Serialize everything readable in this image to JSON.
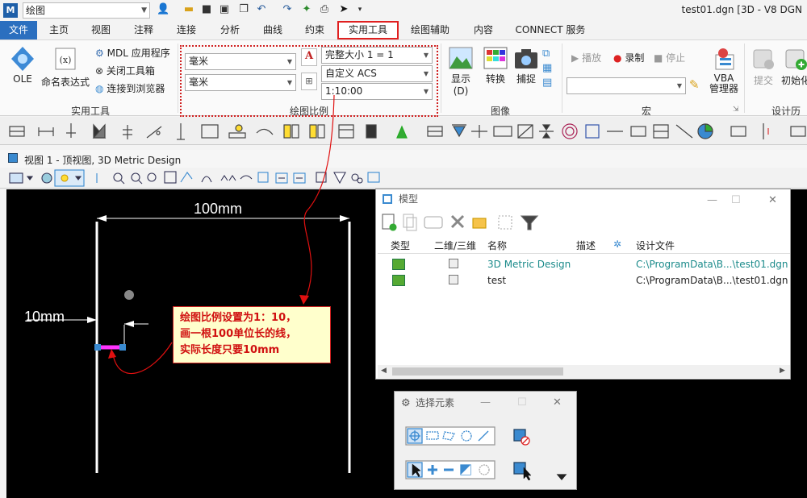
{
  "window": {
    "workspace": "绘图",
    "title": "test01.dgn [3D - V8 DGN"
  },
  "tabs": [
    "文件",
    "主页",
    "视图",
    "注释",
    "连接",
    "分析",
    "曲线",
    "约束",
    "实用工具",
    "绘图辅助",
    "内容",
    "CONNECT 服务"
  ],
  "active_tab": "实用工具",
  "ribbon": {
    "utility": {
      "ole": "OLE",
      "named_expr": "命名表达式",
      "mdl": "MDL 应用程序",
      "close_toolbox": "关闭工具箱",
      "connect_browser": "连接到浏览器",
      "label": "实用工具"
    },
    "scale": {
      "unit1": "毫米",
      "unit2": "毫米",
      "fullsize": "完整大小 1 = 1",
      "acs": "自定义 ACS",
      "ratio": "1:10:00",
      "label": "绘图比例"
    },
    "image": {
      "display": "显示(D)",
      "convert": "转换",
      "capture": "捕捉",
      "label": "图像"
    },
    "macro": {
      "play": "播放",
      "record": "录制",
      "stop": "停止",
      "vba": "VBA",
      "vba2": "管理器",
      "label": "宏"
    },
    "history": {
      "submit": "提交",
      "init": "初始化",
      "label": "设计历史"
    }
  },
  "view": {
    "title": "视图 1 - 顶视图, 3D Metric Design"
  },
  "drawing": {
    "dim_top": "100mm",
    "dim_left": "10mm",
    "note_line1": "绘图比例设置为1：10，",
    "note_line2": "画一根100单位长的线，",
    "note_line3": "实际长度只要10mm"
  },
  "model_dialog": {
    "title": "模型",
    "columns": [
      "类型",
      "二维/三维",
      "名称",
      "描述",
      "设计文件"
    ],
    "rows": [
      {
        "name": "3D Metric Design",
        "file": "C:\\ProgramData\\B...\\test01.dgn"
      },
      {
        "name": "test",
        "file": "C:\\ProgramData\\B...\\test01.dgn"
      }
    ]
  },
  "select_dialog": {
    "title": "选择元素"
  },
  "colors": {
    "accent": "#2b6fbf",
    "highlight": "#e02020",
    "note_bg": "#ffffcc",
    "model_link": "#1a8a8a"
  }
}
